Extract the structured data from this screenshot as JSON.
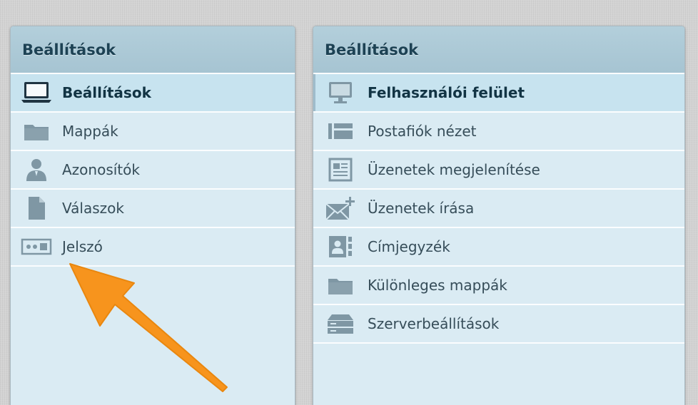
{
  "left_panel": {
    "title": "Beállítások",
    "items": [
      {
        "label": "Beállítások",
        "icon": "laptop-icon",
        "selected": true
      },
      {
        "label": "Mappák",
        "icon": "folder-icon",
        "selected": false
      },
      {
        "label": "Azonosítók",
        "icon": "user-icon",
        "selected": false
      },
      {
        "label": "Válaszok",
        "icon": "document-icon",
        "selected": false
      },
      {
        "label": "Jelszó",
        "icon": "password-icon",
        "selected": false
      }
    ]
  },
  "right_panel": {
    "title": "Beállítások",
    "items": [
      {
        "label": "Felhasználói felület",
        "icon": "monitor-icon",
        "selected": true
      },
      {
        "label": "Postafiók nézet",
        "icon": "mailbox-view-icon",
        "selected": false
      },
      {
        "label": "Üzenetek megjelenítése",
        "icon": "message-view-icon",
        "selected": false
      },
      {
        "label": "Üzenetek írása",
        "icon": "compose-mail-icon",
        "selected": false
      },
      {
        "label": "Címjegyzék",
        "icon": "address-book-icon",
        "selected": false
      },
      {
        "label": "Különleges mappák",
        "icon": "folder-icon",
        "selected": false
      },
      {
        "label": "Szerverbeállítások",
        "icon": "server-icon",
        "selected": false
      }
    ]
  },
  "colors": {
    "panel_bg": "#daebf3",
    "header_bg": "#a6c4d2",
    "selected_bg": "#c7e3ef",
    "icon": "#7f97a4",
    "arrow": "#f7941d"
  },
  "annotation": {
    "type": "arrow",
    "color": "#f7941d",
    "points_to": "Jelszó"
  }
}
